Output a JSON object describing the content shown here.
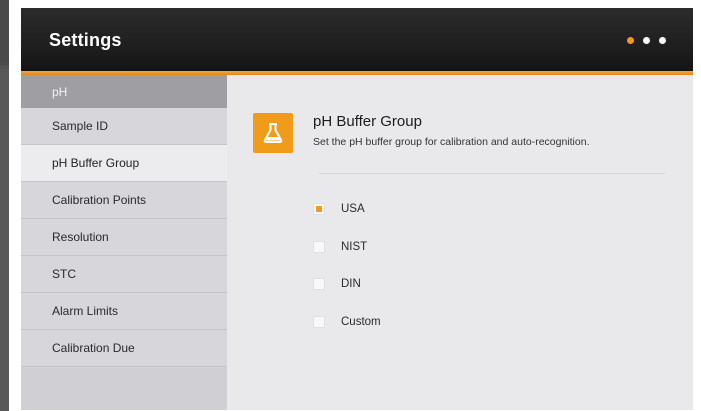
{
  "window": {
    "title": "Settings"
  },
  "pagination": {
    "count": 3,
    "active_index": 0
  },
  "sidebar": {
    "header": "pH",
    "items": [
      {
        "label": "Sample ID"
      },
      {
        "label": "pH Buffer Group",
        "selected": true
      },
      {
        "label": "Calibration Points"
      },
      {
        "label": "Resolution"
      },
      {
        "label": "STC"
      },
      {
        "label": "Alarm Limits"
      },
      {
        "label": "Calibration Due"
      }
    ]
  },
  "panel": {
    "icon": "flask-icon",
    "title": "pH Buffer Group",
    "description": "Set the pH buffer group for calibration and auto-recognition.",
    "options": [
      {
        "label": "USA",
        "checked": true
      },
      {
        "label": "NIST",
        "checked": false
      },
      {
        "label": "DIN",
        "checked": false
      },
      {
        "label": "Custom",
        "checked": false
      }
    ]
  },
  "colors": {
    "accent": "#f19b1b",
    "titlebar": "#1f1f1f",
    "sidebar": "#d6d6db",
    "sidebar_header": "#9e9ea3",
    "content": "#e9e9ec"
  }
}
